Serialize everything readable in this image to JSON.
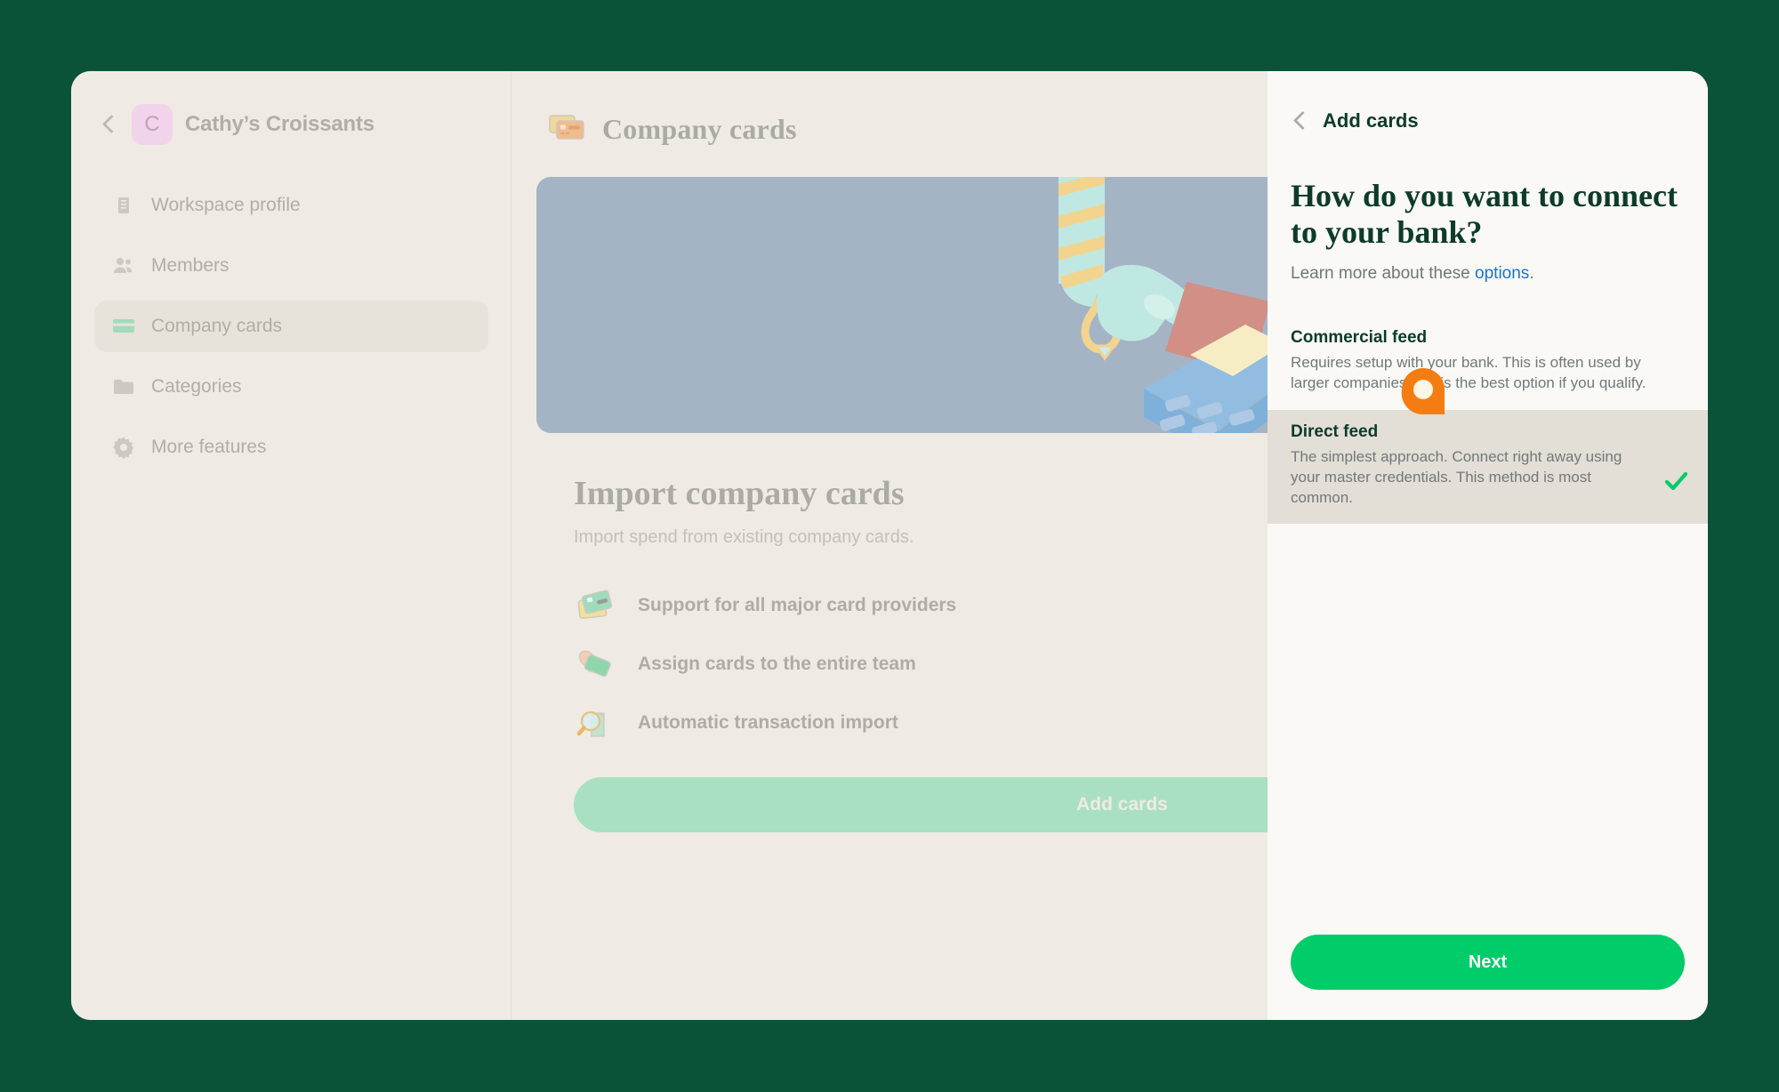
{
  "window": {
    "background_color": "#0b5338",
    "surface_color": "#efebe4"
  },
  "sidebar": {
    "back_icon": "chevron-left-icon",
    "workspace_initial": "C",
    "workspace_name": "Cathy’s Croissants",
    "items": [
      {
        "label": "Workspace profile",
        "icon": "building-icon",
        "active": false
      },
      {
        "label": "Members",
        "icon": "people-icon",
        "active": false
      },
      {
        "label": "Company cards",
        "icon": "card-icon",
        "active": true
      },
      {
        "label": "Categories",
        "icon": "folder-icon",
        "active": false
      },
      {
        "label": "More features",
        "icon": "gear-icon",
        "active": false
      }
    ]
  },
  "main": {
    "header_icon": "two-cards-icon",
    "header_title": "Company cards",
    "hero_illustration": "hand-paying-card-terminal-illustration",
    "hero_color": "#a5b4c4",
    "card_title": "Import company cards",
    "card_subtitle": "Import spend from existing company cards.",
    "features": [
      {
        "icon": "stacked-cards-icon",
        "text": "Support for all major card providers"
      },
      {
        "icon": "hand-holding-card-icon",
        "text": "Assign cards to the entire team"
      },
      {
        "icon": "magnifier-receipts-icon",
        "text": "Automatic transaction import"
      }
    ],
    "cta_label": "Add cards"
  },
  "panel": {
    "back_icon": "chevron-left-icon",
    "title": "Add cards",
    "heading": "How do you want to connect to your bank?",
    "learn_more_prefix": "Learn more about these ",
    "learn_more_link": "options",
    "learn_more_suffix": ".",
    "link_color": "#1a73c8",
    "options": [
      {
        "name": "Commercial feed",
        "description": "Requires setup with your bank. This is often used by larger companies and is the best option if you qualify.",
        "selected": false
      },
      {
        "name": "Direct feed",
        "description": "The simplest approach. Connect right away using your master credentials. This method is most common.",
        "selected": true
      }
    ],
    "check_icon": "green-check-icon",
    "check_color": "#00cc6a",
    "next_label": "Next",
    "next_color": "#00cc6a"
  },
  "cursor": {
    "icon": "orange-pointer-icon",
    "color": "#f57c10"
  }
}
